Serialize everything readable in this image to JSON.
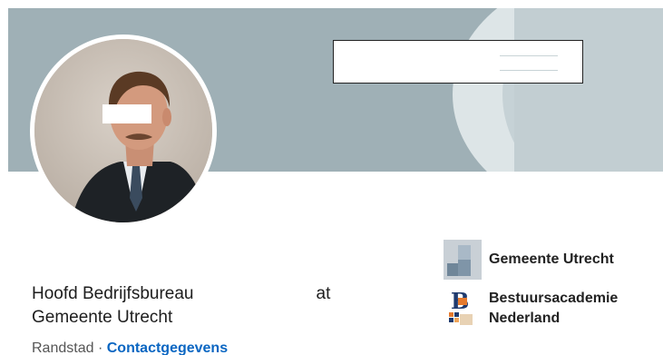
{
  "profile": {
    "headline_part1": "Hoofd Bedrijfsbureau",
    "headline_part2": "at",
    "headline_part3": "Gemeente Utrecht",
    "location": "Randstad",
    "separator": "·",
    "contact_link": "Contactgegevens"
  },
  "organizations": [
    {
      "name": "Gemeente Utrecht",
      "logo": "gemeente-utrecht-logo"
    },
    {
      "name": "Bestuursacademie\nNederland",
      "logo_text": "B",
      "logo": "bestuursacademie-logo"
    }
  ],
  "colors": {
    "banner": "#9fb0b6",
    "link": "#0a66c2",
    "text": "#1d1d1d"
  }
}
